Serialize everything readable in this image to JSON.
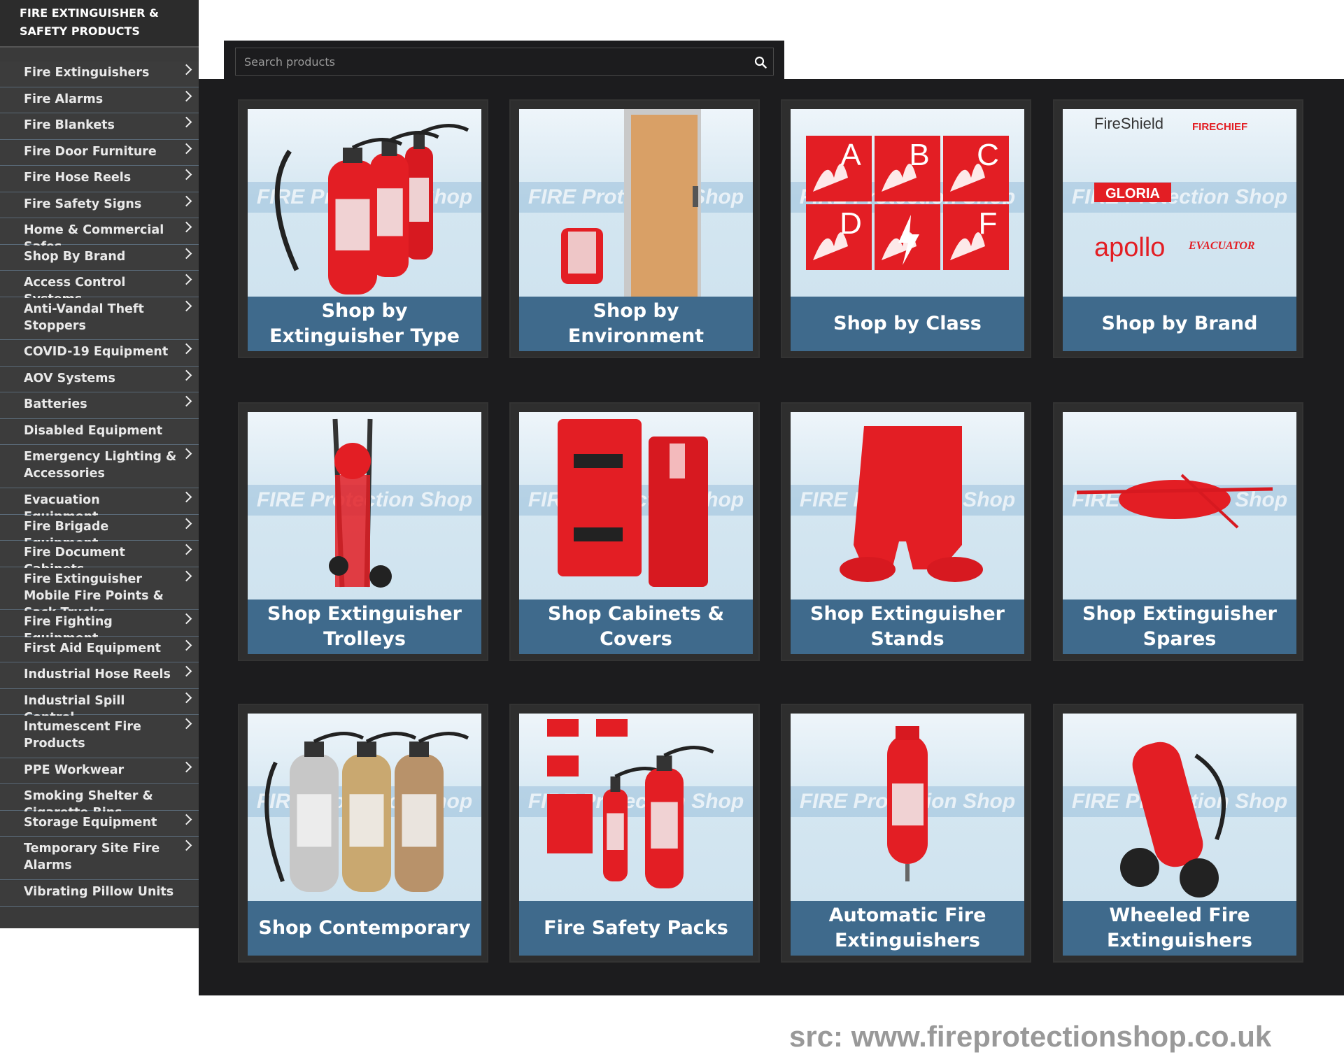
{
  "sidebar": {
    "title": "FIRE EXTINGUISHER & SAFETY PRODUCTS",
    "items": [
      {
        "label": "Fire Extinguishers",
        "chevron": true
      },
      {
        "label": "Fire Alarms",
        "chevron": true
      },
      {
        "label": "Fire Blankets",
        "chevron": true
      },
      {
        "label": "Fire Door Furniture",
        "chevron": true
      },
      {
        "label": "Fire Hose Reels",
        "chevron": true
      },
      {
        "label": "Fire Safety Signs",
        "chevron": true
      },
      {
        "label": "Home & Commercial Safes",
        "chevron": true
      },
      {
        "label": "Shop By Brand",
        "chevron": true
      },
      {
        "label": "Access Control Systems",
        "chevron": true
      },
      {
        "label": "Anti-Vandal Theft Stoppers",
        "chevron": true
      },
      {
        "label": "COVID-19 Equipment",
        "chevron": true
      },
      {
        "label": "AOV Systems",
        "chevron": true
      },
      {
        "label": "Batteries",
        "chevron": true
      },
      {
        "label": "Disabled Equipment",
        "chevron": false
      },
      {
        "label": "Emergency Lighting & Accessories",
        "chevron": true
      },
      {
        "label": "Evacuation Equipment",
        "chevron": true
      },
      {
        "label": "Fire Brigade Equipment",
        "chevron": true
      },
      {
        "label": "Fire Document Cabinets",
        "chevron": true
      },
      {
        "label": "Fire Extinguisher Mobile Fire Points & Sack Trucks",
        "chevron": true
      },
      {
        "label": "Fire Fighting Equipment",
        "chevron": true
      },
      {
        "label": "First Aid Equipment",
        "chevron": true
      },
      {
        "label": "Industrial Hose Reels",
        "chevron": true
      },
      {
        "label": "Industrial Spill Control",
        "chevron": true
      },
      {
        "label": "Intumescent Fire Products",
        "chevron": true
      },
      {
        "label": "PPE Workwear",
        "chevron": true
      },
      {
        "label": "Smoking Shelter & Cigarette Bins",
        "chevron": false
      },
      {
        "label": "Storage Equipment",
        "chevron": true
      },
      {
        "label": "Temporary Site Fire Alarms",
        "chevron": true
      },
      {
        "label": "Vibrating Pillow Units",
        "chevron": false
      }
    ]
  },
  "search": {
    "placeholder": "Search products",
    "icon": "search-icon"
  },
  "watermark": "FIRE Protection Shop",
  "cards": [
    {
      "label": "Shop by Extinguisher Type",
      "image": "extinguishers"
    },
    {
      "label": "Shop by Environment",
      "image": "door"
    },
    {
      "label": "Shop by Class",
      "image": "classes",
      "classes": [
        "A",
        "B",
        "C",
        "D",
        "",
        "F"
      ]
    },
    {
      "label": "Shop by Brand",
      "image": "brands",
      "brands": [
        "FireShield",
        "FIRECHIEF",
        "GLORIA",
        "apollo",
        "EVACUATOR"
      ]
    },
    {
      "label": "Shop Extinguisher Trolleys",
      "image": "trolley"
    },
    {
      "label": "Shop Cabinets & Covers",
      "image": "cabinet"
    },
    {
      "label": "Shop Extinguisher Stands",
      "image": "stand"
    },
    {
      "label": "Shop Extinguisher Spares",
      "image": "spares"
    },
    {
      "label": "Shop Contemporary",
      "image": "contemporary"
    },
    {
      "label": "Fire Safety Packs",
      "image": "packs"
    },
    {
      "label": "Automatic Fire Extinguishers",
      "image": "automatic"
    },
    {
      "label": "Wheeled Fire Extinguishers",
      "image": "wheeled"
    }
  ],
  "colors": {
    "accent": "#3f6a8c",
    "red": "#e31e24",
    "panel": "#1c1c1e",
    "sidebar": "#3c3c3c"
  },
  "footer": {
    "src": "src: www.fireprotectionshop.co.uk"
  }
}
